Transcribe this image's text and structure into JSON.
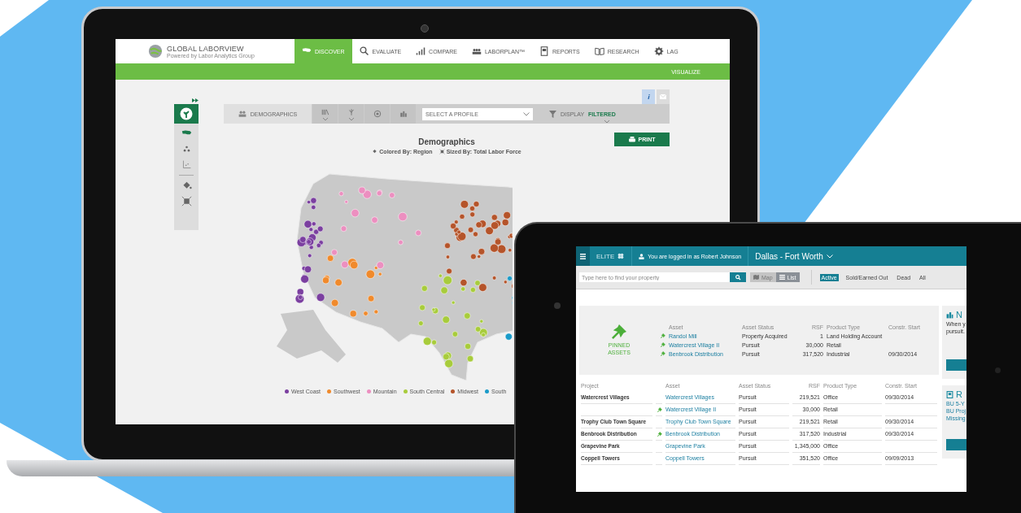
{
  "laptop": {
    "app": {
      "logo_title": "GLOBAL LABORVIEW",
      "logo_subtitle": "Powered by Labor Analytics Group",
      "nav": [
        {
          "label": "DISCOVER",
          "selected": true
        },
        {
          "label": "EVALUATE",
          "selected": false
        },
        {
          "label": "COMPARE",
          "selected": false
        },
        {
          "label": "LABORPLAN™",
          "selected": false
        },
        {
          "label": "REPORTS",
          "selected": false
        },
        {
          "label": "RESEARCH",
          "selected": false
        },
        {
          "label": "LAG",
          "selected": false
        }
      ],
      "subnav_link": "VISUALIZE",
      "toolbar": {
        "demographics": "DEMOGRAPHICS",
        "profile_placeholder": "SELECT A PROFILE",
        "display": "DISPLAY",
        "display_state": "FILTERED"
      },
      "print_button": "PRINT",
      "chart_title": "Demographics",
      "colored_by": "Colored By: Region",
      "sized_by": "Sized By: Total Labor Force",
      "legend": [
        {
          "label": "West Coast",
          "color": "#7b3fa0"
        },
        {
          "label": "Southwest",
          "color": "#f08a2c"
        },
        {
          "label": "Mountain",
          "color": "#ec8fc0"
        },
        {
          "label": "South Central",
          "color": "#a8cc3c"
        },
        {
          "label": "Midwest",
          "color": "#b5542a"
        },
        {
          "label": "South",
          "color": "#1a9bc9"
        }
      ]
    }
  },
  "tablet": {
    "app": {
      "brand": "ELITE",
      "login_text": "You are logged in as Robert Johnson",
      "market": "Dallas - Fort Worth",
      "search": {
        "placeholder": "Type here to find your property"
      },
      "view_toggle": [
        {
          "label": "Map",
          "selected": false
        },
        {
          "label": "List",
          "selected": true
        }
      ],
      "filters": [
        {
          "label": "Active",
          "selected": true
        },
        {
          "label": "Sold/Earned Out",
          "selected": false
        },
        {
          "label": "Dead",
          "selected": false
        },
        {
          "label": "All",
          "selected": false
        }
      ],
      "pinned": {
        "label": "PINNED ASSETS",
        "columns": [
          "Asset",
          "Asset Status",
          "RSF",
          "Product Type",
          "Constr. Start"
        ],
        "rows": [
          {
            "asset": "Randol Mill",
            "status": "Property Acquired",
            "rsf": "1",
            "type": "Land Holding Account"
          },
          {
            "asset": "Watercrest Village II",
            "status": "Pursuit",
            "rsf": "30,000",
            "type": "Retail"
          },
          {
            "asset": "Benbrook Distribution",
            "status": "Pursuit",
            "rsf": "317,520",
            "type": "Industrial",
            "start": "09/30/2014"
          }
        ]
      },
      "table": {
        "columns": [
          "Project",
          "Asset",
          "Asset Status",
          "RSF",
          "Product Type",
          "Constr. Start"
        ],
        "rows": [
          {
            "project": "Watercrest Villages",
            "pinned": false,
            "asset": "Watercrest Villages",
            "status": "Pursuit",
            "rsf": "219,521",
            "type": "Office",
            "start": "09/30/2014"
          },
          {
            "pinned": true,
            "asset": "Watercrest Village II",
            "status": "Pursuit",
            "rsf": "30,000",
            "type": "Retail"
          },
          {
            "project": "Trophy Club Town Square",
            "pinned": false,
            "asset": "Trophy Club Town Square",
            "status": "Pursuit",
            "rsf": "219,521",
            "type": "Retail",
            "start": "09/30/2014"
          },
          {
            "project": "Benbrook Distribution",
            "pinned": true,
            "asset": "Benbrook Distribution",
            "status": "Pursuit",
            "rsf": "317,520",
            "type": "Industrial",
            "start": "09/30/2014"
          },
          {
            "project": "Grapevine Park",
            "pinned": false,
            "asset": "Grapevine Park",
            "status": "Pursuit",
            "rsf": "1,345,000",
            "type": "Office"
          },
          {
            "project": "Coppell Towers",
            "pinned": false,
            "asset": "Coppell Towers",
            "status": "Pursuit",
            "rsf": "351,520",
            "type": "Office",
            "start": "09/09/2013"
          }
        ]
      },
      "side_cards": [
        {
          "title": "N",
          "text": [
            "When y",
            "pursuit."
          ],
          "button": true
        },
        {
          "title": "R",
          "links": [
            "BU 5-Y",
            "BU Proj",
            "Missing"
          ],
          "button": true
        }
      ]
    }
  }
}
